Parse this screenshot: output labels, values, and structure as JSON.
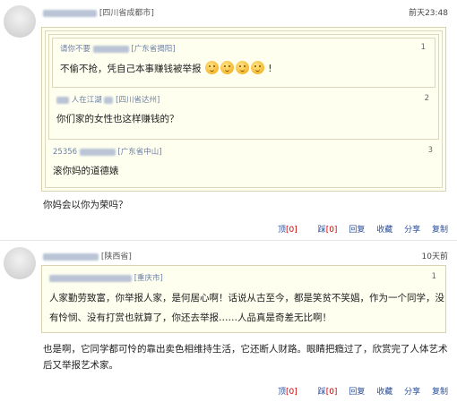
{
  "comments": [
    {
      "location": "[四川省成都市]",
      "time": "前天23:48",
      "quotes": [
        {
          "user_suffix": "请你不要",
          "location": "[广东省揭阳]",
          "index": "1",
          "text": "不偷不抢，凭自己本事赚钱被举报",
          "text_suffix": "!"
        },
        {
          "user_suffix": "人在江湖",
          "location": "[四川省达州]",
          "index": "2",
          "text": "你们家的女性也这样赚钱的？"
        },
        {
          "user_suffix": "25356",
          "location": "[广东省中山]",
          "index": "3",
          "text": "滚你妈的道德婊"
        }
      ],
      "body": "你妈会以你为荣吗？",
      "actions": {
        "up": "顶",
        "up_count": "[0]",
        "down": "踩",
        "down_count": "[0]",
        "reply": "回复",
        "favorite": "收藏",
        "share": "分享",
        "copy": "复制"
      }
    },
    {
      "location": "[陕西省]",
      "time": "10天前",
      "quote": {
        "location": "[重庆市]",
        "index": "1",
        "lines": [
          "人家勤劳致富，你举报人家，是何居心啊！话说从古至今，都是笑贫不笑娼，作为一个同学，没",
          "有怜悯、没有打赏也就算了，你还去举报……人品真是奇差无比啊！"
        ]
      },
      "body_lines": [
        "也是啊，它同学都可怜的靠出卖色相维持生活，它还断人财路。眼睛把瘾过了，欣赏完了人体艺术",
        "后又举报艺术家。"
      ],
      "actions": {
        "up": "顶",
        "up_count": "[0]",
        "down": "踩",
        "down_count": "[0]",
        "reply": "回复",
        "favorite": "收藏",
        "share": "分享",
        "copy": "复制"
      }
    }
  ]
}
